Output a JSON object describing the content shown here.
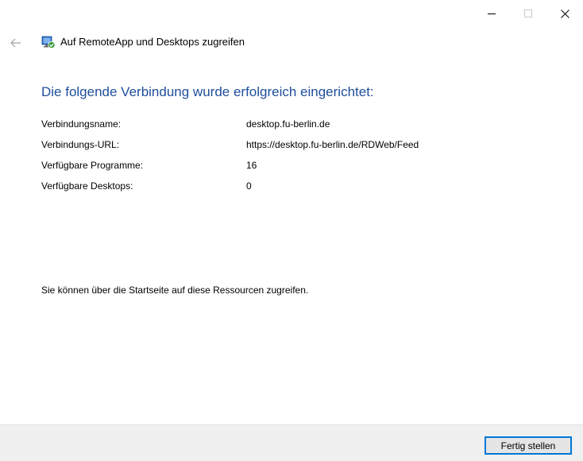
{
  "window": {
    "minimize_icon": "minimize-icon",
    "maximize_icon": "maximize-icon",
    "close_icon": "close-icon"
  },
  "header": {
    "back_icon": "back-arrow-icon",
    "app_icon": "remoteapp-icon",
    "title": "Auf RemoteApp und Desktops zugreifen"
  },
  "main": {
    "heading": "Die folgende Verbindung wurde erfolgreich eingerichtet:",
    "details": [
      {
        "label": "Verbindungsname:",
        "value": "desktop.fu-berlin.de"
      },
      {
        "label": "Verbindungs-URL:",
        "value": "https://desktop.fu-berlin.de/RDWeb/Feed"
      },
      {
        "label": "Verfügbare Programme:",
        "value": "16"
      },
      {
        "label": "Verfügbare Desktops:",
        "value": "0"
      }
    ],
    "info": "Sie können über die Startseite auf diese Ressourcen zugreifen."
  },
  "footer": {
    "finish_label": "Fertig stellen"
  },
  "colors": {
    "heading": "#1f4e9c",
    "footer_bg": "#f0f0f0",
    "button_border": "#0078d7"
  }
}
